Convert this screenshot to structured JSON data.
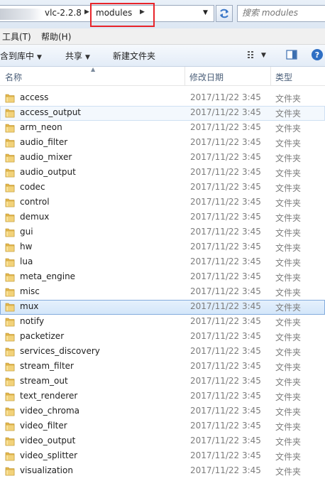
{
  "address_bar": {
    "crumbs": [
      "vlc-2.2.8",
      "modules"
    ],
    "search_placeholder": "搜索 modules"
  },
  "menu": {
    "items": [
      "工具(T)",
      "帮助(H)"
    ]
  },
  "command_bar": {
    "include_in_library": "含到库中",
    "share": "共享",
    "new_folder": "新建文件夹"
  },
  "columns": {
    "name": "名称",
    "modified": "修改日期",
    "type": "类型"
  },
  "colors": {
    "highlight_box": "#e8242a",
    "selection": "#d3e6fa",
    "folder": "#e9c15a"
  },
  "files": [
    {
      "name": "access",
      "date": "2017/11/22 3:45",
      "type": "文件夹"
    },
    {
      "name": "access_output",
      "date": "2017/11/22 3:45",
      "type": "文件夹"
    },
    {
      "name": "arm_neon",
      "date": "2017/11/22 3:45",
      "type": "文件夹"
    },
    {
      "name": "audio_filter",
      "date": "2017/11/22 3:45",
      "type": "文件夹"
    },
    {
      "name": "audio_mixer",
      "date": "2017/11/22 3:45",
      "type": "文件夹"
    },
    {
      "name": "audio_output",
      "date": "2017/11/22 3:45",
      "type": "文件夹"
    },
    {
      "name": "codec",
      "date": "2017/11/22 3:45",
      "type": "文件夹"
    },
    {
      "name": "control",
      "date": "2017/11/22 3:45",
      "type": "文件夹"
    },
    {
      "name": "demux",
      "date": "2017/11/22 3:45",
      "type": "文件夹"
    },
    {
      "name": "gui",
      "date": "2017/11/22 3:45",
      "type": "文件夹"
    },
    {
      "name": "hw",
      "date": "2017/11/22 3:45",
      "type": "文件夹"
    },
    {
      "name": "lua",
      "date": "2017/11/22 3:45",
      "type": "文件夹"
    },
    {
      "name": "meta_engine",
      "date": "2017/11/22 3:45",
      "type": "文件夹"
    },
    {
      "name": "misc",
      "date": "2017/11/22 3:45",
      "type": "文件夹"
    },
    {
      "name": "mux",
      "date": "2017/11/22 3:45",
      "type": "文件夹",
      "selected": true
    },
    {
      "name": "notify",
      "date": "2017/11/22 3:45",
      "type": "文件夹"
    },
    {
      "name": "packetizer",
      "date": "2017/11/22 3:45",
      "type": "文件夹"
    },
    {
      "name": "services_discovery",
      "date": "2017/11/22 3:45",
      "type": "文件夹"
    },
    {
      "name": "stream_filter",
      "date": "2017/11/22 3:45",
      "type": "文件夹"
    },
    {
      "name": "stream_out",
      "date": "2017/11/22 3:45",
      "type": "文件夹"
    },
    {
      "name": "text_renderer",
      "date": "2017/11/22 3:45",
      "type": "文件夹"
    },
    {
      "name": "video_chroma",
      "date": "2017/11/22 3:45",
      "type": "文件夹"
    },
    {
      "name": "video_filter",
      "date": "2017/11/22 3:45",
      "type": "文件夹"
    },
    {
      "name": "video_output",
      "date": "2017/11/22 3:45",
      "type": "文件夹"
    },
    {
      "name": "video_splitter",
      "date": "2017/11/22 3:45",
      "type": "文件夹"
    },
    {
      "name": "visualization",
      "date": "2017/11/22 3:45",
      "type": "文件夹"
    }
  ]
}
